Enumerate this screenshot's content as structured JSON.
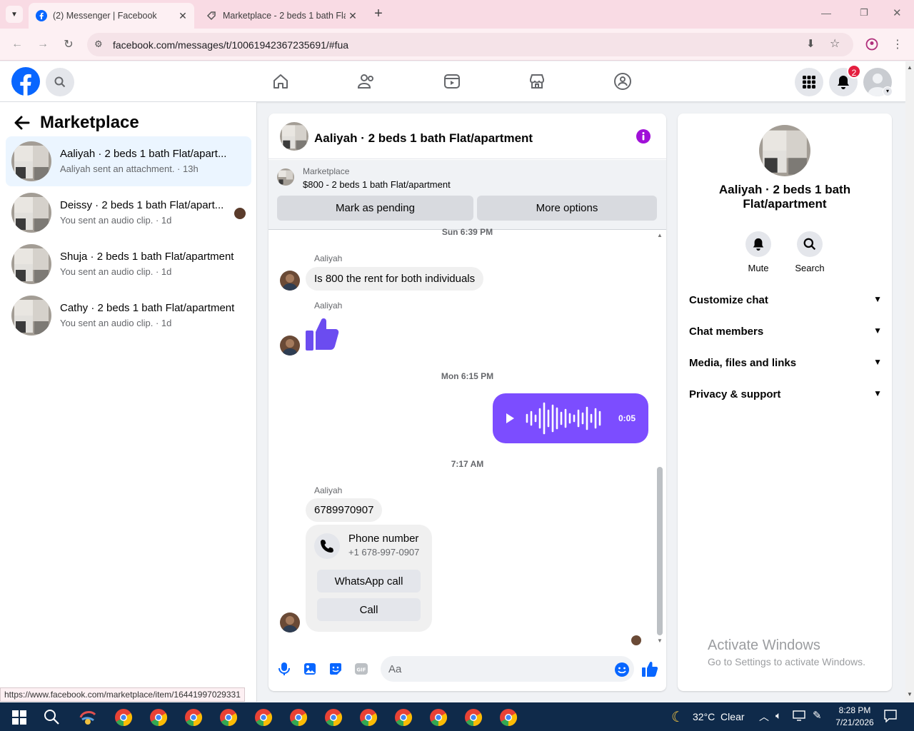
{
  "browser": {
    "tabs": [
      {
        "title": "(2) Messenger | Facebook",
        "active": true
      },
      {
        "title": "Marketplace - 2 beds 1 bath Fla",
        "active": false
      }
    ],
    "url": "facebook.com/messages/t/10061942367235691/#fua",
    "status_url": "https://www.facebook.com/marketplace/item/16441997029331"
  },
  "header": {
    "notification_count": "2",
    "brand_color": "#0866ff"
  },
  "left_panel": {
    "title": "Marketplace",
    "conversations": [
      {
        "name": "Aaliyah · 2 beds 1 bath Flat/apart...",
        "preview": "Aaliyah sent an attachment.",
        "time": "13h",
        "selected": true
      },
      {
        "name": "Deissy · 2 beds 1 bath Flat/apart...",
        "preview": "You sent an audio clip.",
        "time": "1d",
        "selected": false
      },
      {
        "name": "Shuja · 2 beds 1 bath Flat/apartment",
        "preview": "You sent an audio clip.",
        "time": "1d",
        "selected": false
      },
      {
        "name": "Cathy · 2 beds 1 bath Flat/apartment",
        "preview": "You sent an audio clip.",
        "time": "1d",
        "selected": false
      }
    ]
  },
  "chat": {
    "title": "Aaliyah · 2 beds 1 bath Flat/apartment",
    "marketplace_label": "Marketplace",
    "listing": "$800 - 2 beds 1 bath Flat/apartment",
    "mark_pending": "Mark as pending",
    "more_options": "More options",
    "ts1": "Sun 6:39 PM",
    "sender1": "Aaliyah",
    "msg1": "Is 800 the rent for both individuals",
    "sender2": "Aaliyah",
    "ts2": "Mon 6:15 PM",
    "audio_duration": "0:05",
    "ts3": "7:17 AM",
    "sender3": "Aaliyah",
    "msg3": "6789970907",
    "phone_card": {
      "title": "Phone number",
      "number": "+1 678-997-0907",
      "whatsapp": "WhatsApp call",
      "call": "Call"
    },
    "input_placeholder": "Aa",
    "accent_color": "#7c4dff"
  },
  "info_panel": {
    "name": "Aaliyah · 2 beds 1 bath Flat/apartment",
    "mute": "Mute",
    "search": "Search",
    "sections": [
      "Customize chat",
      "Chat members",
      "Media, files and links",
      "Privacy & support"
    ],
    "watermark_title": "Activate Windows",
    "watermark_sub": "Go to Settings to activate Windows."
  },
  "taskbar": {
    "weather": "32°C  Clear",
    "time": "8:28 PM",
    "date": "7/21/2026"
  }
}
